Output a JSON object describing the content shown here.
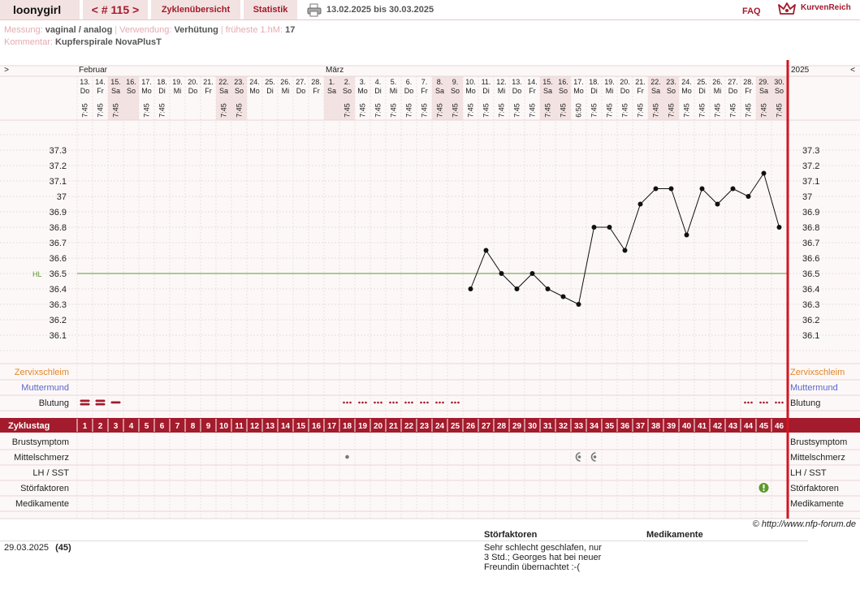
{
  "header": {
    "username": "loonygirl",
    "cycle_nav": "< # 115 >",
    "tab_overview": "Zyklenübersicht",
    "tab_stats": "Statistik",
    "date_range": "13.02.2025 bis 30.03.2025",
    "faq": "FAQ",
    "brand": "KurvenReich"
  },
  "info": {
    "messung_label": "Messung:",
    "messung_value": "vaginal / analog",
    "verwendung_label": "Verwendung:",
    "verwendung_value": "Verhütung",
    "fruheste_label": "früheste 1.hM:",
    "fruheste_value": "17",
    "kommentar_label": "Kommentar:",
    "kommentar_value": "Kupferspirale NovaPlusT"
  },
  "chart_data": {
    "type": "line",
    "left_arrow": ">",
    "right_arrow": "<",
    "months": [
      {
        "label": "Februar",
        "day_index": 0
      },
      {
        "label": "März",
        "day_index": 16
      }
    ],
    "year": "2025",
    "days": [
      "13.",
      "14.",
      "15.",
      "16.",
      "17.",
      "18.",
      "19.",
      "20.",
      "21.",
      "22.",
      "23.",
      "24.",
      "25.",
      "26.",
      "27.",
      "28.",
      "1.",
      "2.",
      "3.",
      "4.",
      "5.",
      "6.",
      "7.",
      "8.",
      "9.",
      "10.",
      "11.",
      "12.",
      "13.",
      "14.",
      "15.",
      "16.",
      "17.",
      "18.",
      "19.",
      "20.",
      "21.",
      "22.",
      "23.",
      "24.",
      "25.",
      "26.",
      "27.",
      "28.",
      "29.",
      "30."
    ],
    "weekdays": [
      "Do",
      "Fr",
      "Sa",
      "So",
      "Mo",
      "Di",
      "Mi",
      "Do",
      "Fr",
      "Sa",
      "So",
      "Mo",
      "Di",
      "Mi",
      "Do",
      "Fr",
      "Sa",
      "So",
      "Mo",
      "Di",
      "Mi",
      "Do",
      "Fr",
      "Sa",
      "So",
      "Mo",
      "Di",
      "Mi",
      "Do",
      "Fr",
      "Sa",
      "So",
      "Mo",
      "Di",
      "Mi",
      "Do",
      "Fr",
      "Sa",
      "So",
      "Mo",
      "Di",
      "Mi",
      "Do",
      "Fr",
      "Sa",
      "So"
    ],
    "times": [
      "7:45",
      "7:45",
      "7:45",
      "",
      "7:45",
      "7:45",
      "",
      "",
      "",
      "7:45",
      "7:45",
      "",
      "",
      "",
      "",
      "",
      "",
      "7:45",
      "7:45",
      "7:45",
      "7:45",
      "7:45",
      "7:45",
      "7:45",
      "7:45",
      "7:45",
      "7:45",
      "7:45",
      "7:45",
      "7:45",
      "7:45",
      "7:45",
      "6:50",
      "7:45",
      "7:45",
      "7:45",
      "7:45",
      "7:45",
      "7:45",
      "7:45",
      "7:45",
      "7:45",
      "7:45",
      "7:45",
      "7:45",
      "7:45"
    ],
    "temps": [
      null,
      null,
      null,
      null,
      null,
      null,
      null,
      null,
      null,
      null,
      null,
      null,
      null,
      null,
      null,
      null,
      null,
      null,
      null,
      null,
      null,
      null,
      null,
      null,
      null,
      36.4,
      36.65,
      36.5,
      36.4,
      36.5,
      36.4,
      36.35,
      36.3,
      36.8,
      36.8,
      36.65,
      36.95,
      37.05,
      37.05,
      36.75,
      37.05,
      36.95,
      37.05,
      37.0,
      37.15,
      36.8
    ],
    "ylim": [
      36.0,
      37.4
    ],
    "y_ticks": [
      36.1,
      36.2,
      36.3,
      36.4,
      36.5,
      36.6,
      36.7,
      36.8,
      36.9,
      37,
      37.1,
      37.2,
      37.3
    ],
    "hl_label": "HL",
    "hl_value": 36.5,
    "cycle_days": [
      "1",
      "2",
      "3",
      "4",
      "5",
      "6",
      "7",
      "8",
      "9",
      "10",
      "11",
      "12",
      "13",
      "14",
      "15",
      "16",
      "17",
      "18",
      "19",
      "20",
      "21",
      "22",
      "23",
      "24",
      "25",
      "26",
      "27",
      "28",
      "29",
      "30",
      "31",
      "32",
      "33",
      "34",
      "35",
      "36",
      "37",
      "38",
      "39",
      "40",
      "41",
      "42",
      "43",
      "44",
      "45",
      "46"
    ],
    "bleeding": [
      "heavy",
      "heavy",
      "medium",
      "",
      "",
      "",
      "",
      "",
      "",
      "",
      "",
      "",
      "",
      "",
      "",
      "",
      "",
      "spotting",
      "spotting",
      "spotting",
      "spotting",
      "spotting",
      "spotting",
      "spotting",
      "spotting",
      "",
      "",
      "",
      "",
      "",
      "",
      "",
      "",
      "",
      "",
      "",
      "",
      "",
      "",
      "",
      "",
      "",
      "",
      "spotting",
      "spotting",
      "spotting"
    ],
    "mittelschmerz": [
      {
        "day_index": 17,
        "type": "dot"
      },
      {
        "day_index": 32,
        "type": "left"
      },
      {
        "day_index": 33,
        "type": "right"
      }
    ],
    "stoerfaktor_days": [
      44
    ],
    "labels": {
      "zervix": "Zervixschleim",
      "mutter": "Muttermund",
      "blutung": "Blutung",
      "zyklustag": "Zyklustag",
      "brust": "Brustsymptom",
      "mittel": "Mittelschmerz",
      "lh": "LH / SST",
      "stoer": "Störfaktoren",
      "medi": "Medikamente"
    },
    "colors": {
      "accent": "#a31b2c",
      "weekend": "#f3e2e2",
      "line": "#111111",
      "hl": "#5c9a2d",
      "zervix": "#e2862a",
      "mutter": "#5967c9",
      "stoer": "#5c9a2d"
    }
  },
  "footer": {
    "copyright": "© http://www.nfp-forum.de",
    "date": "29.03.2025",
    "day_no": "(45)",
    "stoer_head": "Störfaktoren",
    "med_head": "Medikamente",
    "stoer_text": "Sehr schlecht geschlafen, nur 3 Std.; Georges hat bei neuer Freundin übernachtet :-("
  }
}
